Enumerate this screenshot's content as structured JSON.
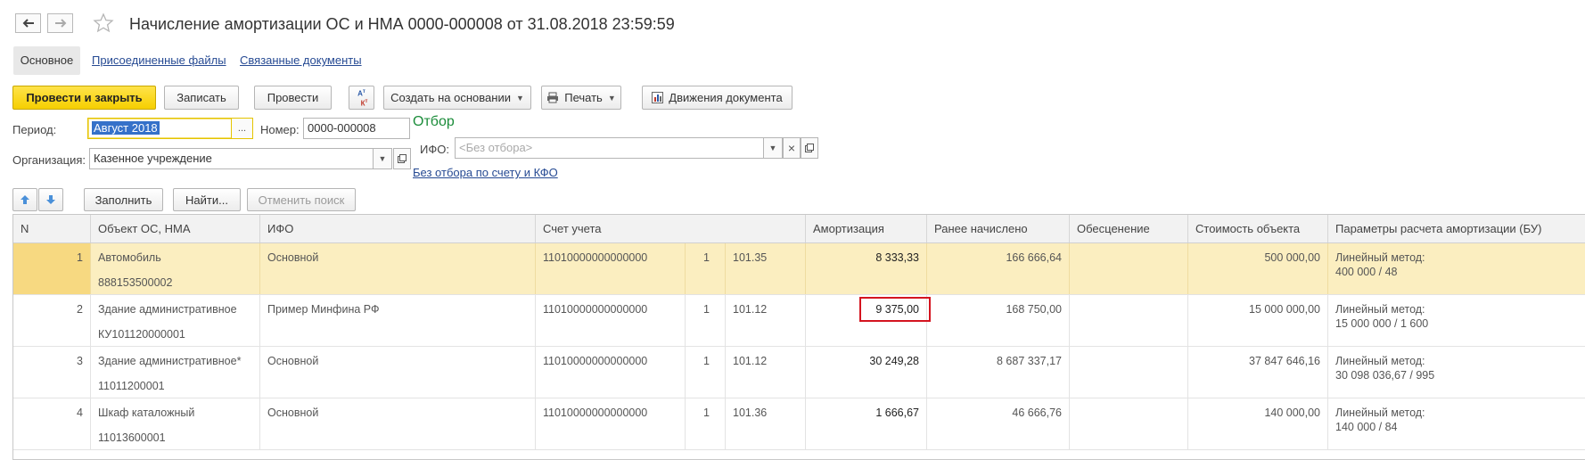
{
  "header": {
    "title": "Начисление амортизации ОС и НМА 0000-000008 от 31.08.2018 23:59:59"
  },
  "tabs": [
    {
      "label": "Основное"
    },
    {
      "label": "Присоединенные файлы"
    },
    {
      "label": "Связанные документы"
    }
  ],
  "toolbar": {
    "post_close": "Провести и закрыть",
    "save": "Записать",
    "post": "Провести",
    "dt_kt_icon": "Ат Кт",
    "create_based": "Создать на основании",
    "print": "Печать",
    "movements": "Движения документа"
  },
  "form": {
    "period_label": "Период:",
    "period_value": "Август 2018",
    "number_label": "Номер:",
    "number_value": "0000-000008",
    "org_label": "Организация:",
    "org_value": "Казенное учреждение",
    "filter_heading": "Отбор",
    "ifo_label": "ИФО:",
    "ifo_placeholder": "<Без отбора>",
    "account_filter_link": "Без отбора по счету и КФО",
    "ellipsis": "...",
    "clear_x": "×"
  },
  "grid_toolbar": {
    "fill": "Заполнить",
    "find": "Найти...",
    "cancel_search": "Отменить поиск"
  },
  "table": {
    "columns": [
      "N",
      "Объект ОС, НМА",
      "ИФО",
      "Счет учета",
      "Амортизация",
      "Ранее начислено",
      "Обесценение",
      "Стоимость объекта",
      "Параметры расчета амортизации (БУ)"
    ],
    "rows": [
      {
        "n": "1",
        "object": "Автомобиль",
        "inv": "888153500002",
        "ifo": "Основной",
        "acc": "11010000000000000",
        "kfo": "1",
        "sub": "101.35",
        "amort": "8 333,33",
        "prev": "166 666,64",
        "imp": "",
        "cost": "500 000,00",
        "method": "Линейный метод:",
        "formula": "400 000 / 48"
      },
      {
        "n": "2",
        "object": "Здание административное",
        "inv": "КУ101120000001",
        "ifo": "Пример Минфина РФ",
        "acc": "11010000000000000",
        "kfo": "1",
        "sub": "101.12",
        "amort": "9 375,00",
        "prev": "168 750,00",
        "imp": "",
        "cost": "15 000 000,00",
        "method": "Линейный метод:",
        "formula": "15 000 000 / 1 600"
      },
      {
        "n": "3",
        "object": "Здание административное*",
        "inv": "11011200001",
        "ifo": "Основной",
        "acc": "11010000000000000",
        "kfo": "1",
        "sub": "101.12",
        "amort": "30 249,28",
        "prev": "8 687 337,17",
        "imp": "",
        "cost": "37 847 646,16",
        "method": "Линейный метод:",
        "formula": "30 098 036,67 / 995"
      },
      {
        "n": "4",
        "object": "Шкаф каталожный",
        "inv": "11013600001",
        "ifo": "Основной",
        "acc": "11010000000000000",
        "kfo": "1",
        "sub": "101.36",
        "amort": "1 666,67",
        "prev": "46 666,76",
        "imp": "",
        "cost": "140 000,00",
        "method": "Линейный метод:",
        "formula": "140 000 / 84"
      }
    ]
  },
  "colors": {
    "accent_yellow": "#f6cf00",
    "selected_row": "#fbeec0",
    "highlight_red": "#d4141f",
    "filter_green": "#1b8c3a",
    "link_blue": "#264a93"
  }
}
